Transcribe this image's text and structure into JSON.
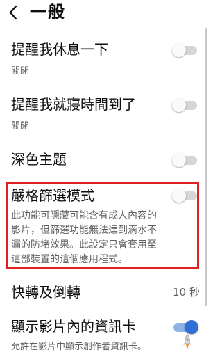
{
  "header": {
    "title": "一般"
  },
  "settings": [
    {
      "title": "提醒我休息一下",
      "subtitle": "關閉",
      "toggle_on": false
    },
    {
      "title": "提醒我就寢時間到了",
      "subtitle": "關閉",
      "toggle_on": false
    },
    {
      "title": "深色主題",
      "toggle_on": false
    },
    {
      "title": "嚴格篩選模式",
      "toggle_on": false,
      "description_lines": [
        "此功能可隱藏可能含有成人內容的",
        "影片，但篩選功能無法達到滴水不",
        "漏的防堵效果。此設定只會套用至",
        "這部裝置的這個應用程式。"
      ]
    },
    {
      "title": "快轉及倒轉",
      "value": "10 秒"
    },
    {
      "title": "顯示影片內的資訊卡",
      "subtitle": "允許在影片中顯示創作者資訊卡。",
      "toggle_on": true
    }
  ],
  "colors": {
    "highlight_border": "#e02020",
    "toggle_on": "#2f6fd8"
  }
}
